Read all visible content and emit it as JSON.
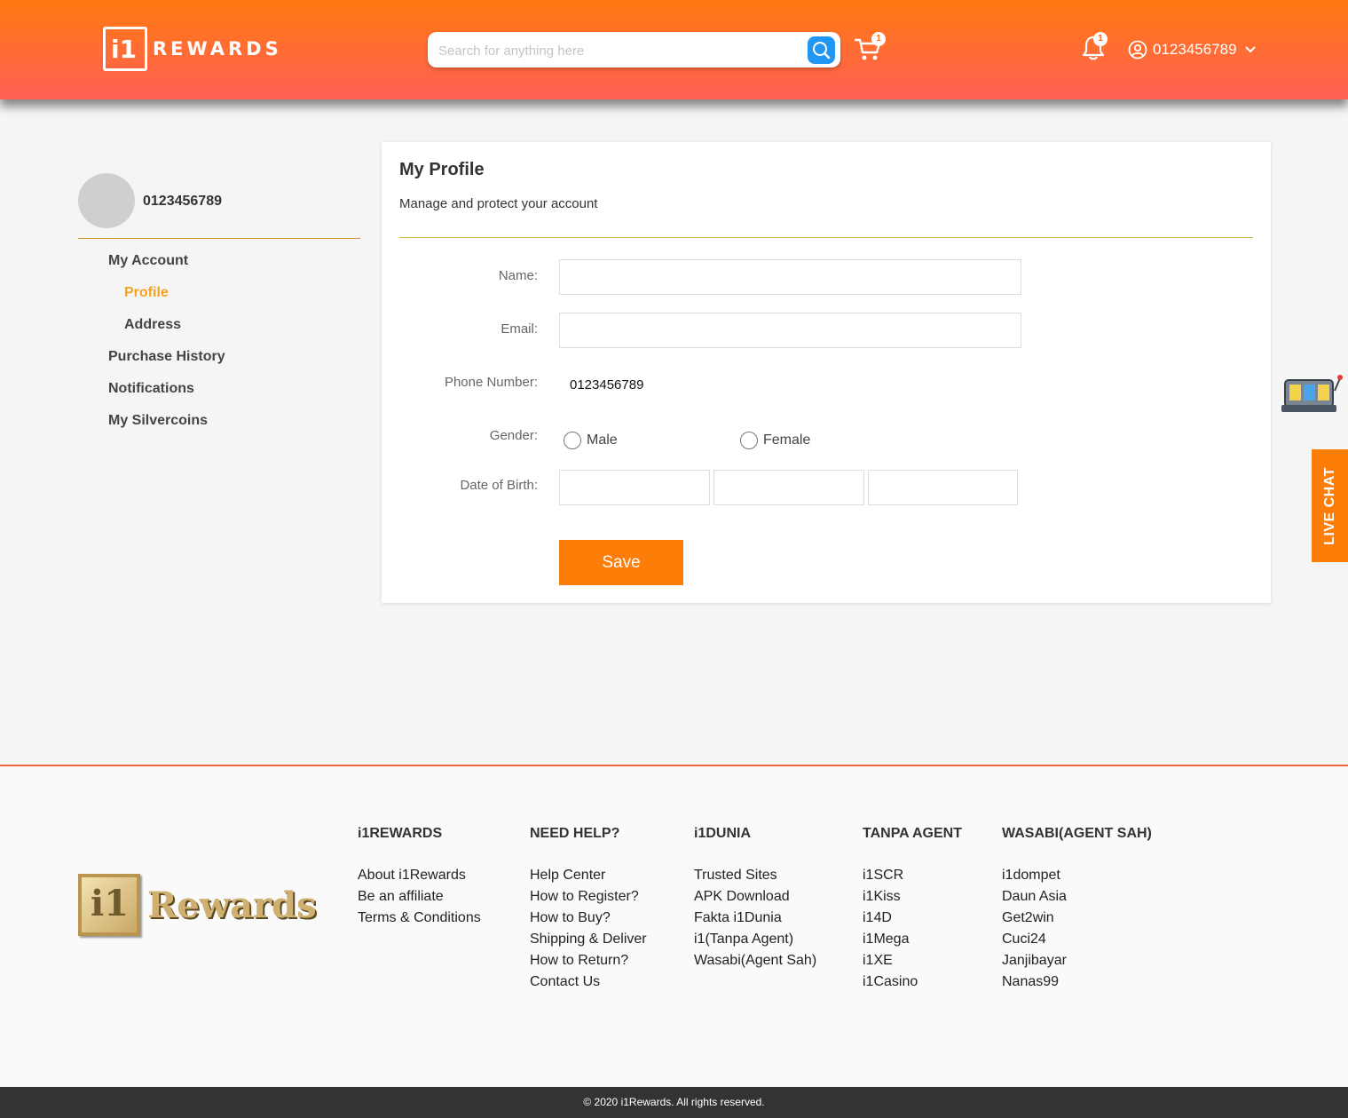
{
  "brand": {
    "logo_mark": "i1",
    "logo_text": "REWARDS"
  },
  "header": {
    "search_placeholder": "Search for anything here",
    "cart_count": "1",
    "notification_count": "1",
    "username": "0123456789"
  },
  "sidebar": {
    "username": "0123456789",
    "items": [
      {
        "label": "My Account"
      },
      {
        "label": "Profile"
      },
      {
        "label": "Address"
      },
      {
        "label": "Purchase History"
      },
      {
        "label": "Notifications"
      },
      {
        "label": "My Silvercoins"
      }
    ],
    "active": "Profile"
  },
  "profile": {
    "title": "My Profile",
    "subtitle": "Manage and protect your account",
    "name_label": "Name:",
    "name_value": "",
    "email_label": "Email:",
    "email_value": "",
    "phone_label": "Phone Number:",
    "phone_value": "0123456789",
    "gender_label": "Gender:",
    "gender_options": [
      "Male",
      "Female"
    ],
    "dob_label": "Date of Birth:",
    "save_label": "Save"
  },
  "live_chat": "LIVE CHAT",
  "footer": {
    "logo_mark": "i1",
    "logo_text": "Rewards",
    "columns": [
      {
        "heading": "i1REWARDS",
        "links": [
          "About i1Rewards",
          "Be an affiliate",
          "Terms & Conditions"
        ]
      },
      {
        "heading": "NEED HELP?",
        "links": [
          "Help Center",
          "How to Register?",
          "How to Buy?",
          "Shipping & Deliver",
          "How to Return?",
          "Contact Us"
        ]
      },
      {
        "heading": "i1DUNIA",
        "links": [
          "Trusted Sites",
          "APK Download",
          "Fakta i1Dunia",
          "i1(Tanpa Agent)",
          "Wasabi(Agent Sah)"
        ]
      },
      {
        "heading": "TANPA AGENT",
        "links": [
          "i1SCR",
          "i1Kiss",
          "i14D",
          "i1Mega",
          "i1XE",
          "i1Casino"
        ]
      },
      {
        "heading": "WASABI(AGENT SAH)",
        "links": [
          "i1dompet",
          "Daun Asia",
          "Get2win",
          "Cuci24",
          "Janjibayar",
          "Nanas99"
        ]
      }
    ],
    "copyright": "© 2020 i1Rewards. All rights reserved."
  },
  "colors": {
    "accent": "#fc7d08",
    "active_link": "#f7a21a",
    "search_button": "#2196f3"
  },
  "icons": [
    "search-icon",
    "cart-icon",
    "bell-icon",
    "user-circle-icon",
    "chevron-down-icon",
    "slot-machine-icon"
  ]
}
